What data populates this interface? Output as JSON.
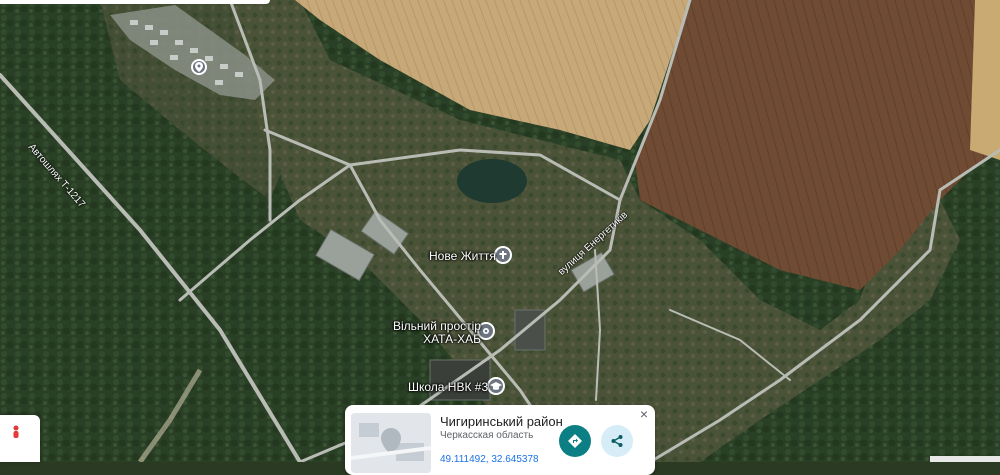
{
  "map": {
    "view": "satellite",
    "colors": {
      "forest": "#2c4227",
      "field_light": "#c8aa7c",
      "field_brown": "#6e4a33",
      "water": "#1f3a30",
      "road": "#b9bcb5",
      "pin": "#6b7480",
      "accent": "#0b7f84"
    }
  },
  "places": [
    {
      "name": "Нове Життя",
      "icon": "church-icon"
    },
    {
      "name": "Вільний простір\nХАТА-ХАБ",
      "icon": "place-pin-icon"
    },
    {
      "name": "Школа НВК #3",
      "icon": "school-icon"
    },
    {
      "name": "",
      "icon": "place-pin-icon"
    }
  ],
  "roads": {
    "highway": "Автошлях Т-1217",
    "street": "вулиця Енергетиків"
  },
  "info_card": {
    "title": "Чигиринський район",
    "subtitle": "Черкасская область",
    "coordinates": "49.111492, 32.645378",
    "close_icon": "close-icon",
    "directions_icon": "directions-icon",
    "share_icon": "share-icon"
  },
  "controls": {
    "street_view_icon": "pegman-icon"
  }
}
